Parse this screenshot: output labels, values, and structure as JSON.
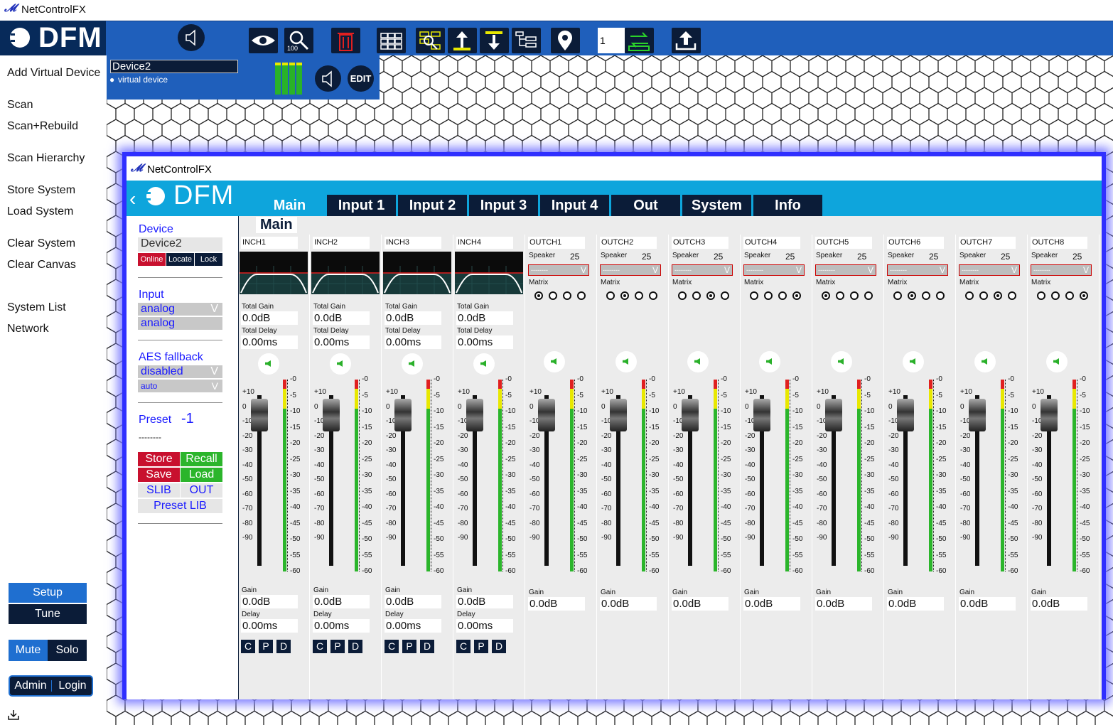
{
  "app": {
    "title": "NetControlFX",
    "logo": "DFM"
  },
  "toolbar": {
    "preset_value": "1",
    "icons": [
      "speaker-icon",
      "eye-icon",
      "zoom-100-icon",
      "trash-icon",
      "grid-icon",
      "find-device-icon",
      "align-top-icon",
      "align-middle-icon",
      "tree-icon",
      "location-pin-icon",
      "transfer-icon",
      "upload-icon"
    ],
    "zoom_badge": "100"
  },
  "sidebar": {
    "items": [
      "Add Virtual Device",
      "Scan",
      "Scan+Rebuild",
      "Scan Hierarchy",
      "Store System",
      "Load System",
      "Clear System",
      "Clear Canvas",
      "System List",
      "Network"
    ],
    "setup": "Setup",
    "tune": "Tune",
    "mute": "Mute",
    "solo": "Solo",
    "admin": "Admin",
    "login": "Login"
  },
  "device_card": {
    "name": "Device2",
    "subtitle": "virtual device",
    "edit": "EDIT"
  },
  "window": {
    "title": "NetControlFX",
    "logo": "DFM",
    "tabs": [
      "Main",
      "Input 1",
      "Input 2",
      "Input 3",
      "Input 4",
      "Out",
      "System",
      "Info"
    ],
    "section": "Main",
    "left": {
      "device_label": "Device",
      "device_name": "Device2",
      "online": "Online",
      "locate": "Locate",
      "lock": "Lock",
      "input_label": "Input",
      "input_sel": "analog",
      "input_val": "analog",
      "aes_label": "AES fallback",
      "aes_sel": "disabled",
      "aes_mode": "auto",
      "preset_label": "Preset",
      "preset_value": "-1",
      "preset_name": "--------",
      "store": "Store",
      "recall": "Recall",
      "save": "Save",
      "load": "Load",
      "slib": "SLIB",
      "out": "OUT",
      "preset_lib": "Preset LIB"
    },
    "inputs": [
      {
        "name": "INCH1",
        "total_gain_label": "Total Gain",
        "total_gain": "0.0dB",
        "total_delay_label": "Total Delay",
        "total_delay": "0.00ms",
        "gain_label": "Gain",
        "gain": "0.0dB",
        "delay_label": "Delay",
        "delay": "0.00ms",
        "c": "C",
        "p": "P",
        "d": "D"
      },
      {
        "name": "INCH2",
        "total_gain_label": "Total Gain",
        "total_gain": "0.0dB",
        "total_delay_label": "Total Delay",
        "total_delay": "0.00ms",
        "gain_label": "Gain",
        "gain": "0.0dB",
        "delay_label": "Delay",
        "delay": "0.00ms",
        "c": "C",
        "p": "P",
        "d": "D"
      },
      {
        "name": "INCH3",
        "total_gain_label": "Total Gain",
        "total_gain": "0.0dB",
        "total_delay_label": "Total Delay",
        "total_delay": "0.00ms",
        "gain_label": "Gain",
        "gain": "0.0dB",
        "delay_label": "Delay",
        "delay": "0.00ms",
        "c": "C",
        "p": "P",
        "d": "D"
      },
      {
        "name": "INCH4",
        "total_gain_label": "Total Gain",
        "total_gain": "0.0dB",
        "total_delay_label": "Total Delay",
        "total_delay": "0.00ms",
        "gain_label": "Gain",
        "gain": "0.0dB",
        "delay_label": "Delay",
        "delay": "0.00ms",
        "c": "C",
        "p": "P",
        "d": "D"
      }
    ],
    "outputs": [
      {
        "name": "OUTCH1",
        "speaker_label": "Speaker",
        "speaker_num": "25",
        "speaker_sel": "--------",
        "matrix_label": "Matrix",
        "matrix_on": 0,
        "gain_label": "Gain",
        "gain": "0.0dB"
      },
      {
        "name": "OUTCH2",
        "speaker_label": "Speaker",
        "speaker_num": "25",
        "speaker_sel": "--------",
        "matrix_label": "Matrix",
        "matrix_on": 1,
        "gain_label": "Gain",
        "gain": "0.0dB"
      },
      {
        "name": "OUTCH3",
        "speaker_label": "Speaker",
        "speaker_num": "25",
        "speaker_sel": "--------",
        "matrix_label": "Matrix",
        "matrix_on": 2,
        "gain_label": "Gain",
        "gain": "0.0dB"
      },
      {
        "name": "OUTCH4",
        "speaker_label": "Speaker",
        "speaker_num": "25",
        "speaker_sel": "--------",
        "matrix_label": "Matrix",
        "matrix_on": 3,
        "gain_label": "Gain",
        "gain": "0.0dB"
      },
      {
        "name": "OUTCH5",
        "speaker_label": "Speaker",
        "speaker_num": "25",
        "speaker_sel": "--------",
        "matrix_label": "Matrix",
        "matrix_on": 0,
        "gain_label": "Gain",
        "gain": "0.0dB"
      },
      {
        "name": "OUTCH6",
        "speaker_label": "Speaker",
        "speaker_num": "25",
        "speaker_sel": "--------",
        "matrix_label": "Matrix",
        "matrix_on": 1,
        "gain_label": "Gain",
        "gain": "0.0dB"
      },
      {
        "name": "OUTCH7",
        "speaker_label": "Speaker",
        "speaker_num": "25",
        "speaker_sel": "--------",
        "matrix_label": "Matrix",
        "matrix_on": 2,
        "gain_label": "Gain",
        "gain": "0.0dB"
      },
      {
        "name": "OUTCH8",
        "speaker_label": "Speaker",
        "speaker_num": "25",
        "speaker_sel": "--------",
        "matrix_label": "Matrix",
        "matrix_on": 3,
        "gain_label": "Gain",
        "gain": "0.0dB"
      }
    ],
    "fader_scale": [
      "+10",
      "0",
      "-10",
      "-20",
      "-30",
      "-40",
      "-50",
      "-60",
      "-70",
      "-80",
      "-90"
    ],
    "meter_scale": [
      "-0",
      "-5",
      "-10",
      "-15",
      "-20",
      "-25",
      "-30",
      "-35",
      "-40",
      "-45",
      "-50",
      "-55",
      "-60"
    ]
  },
  "colors": {
    "accent": "#1f5fbb",
    "dark": "#0b1c38",
    "cyan": "#0ea5dc",
    "border": "#2f2fff",
    "red": "#c8102e",
    "green": "#2bb52b"
  }
}
